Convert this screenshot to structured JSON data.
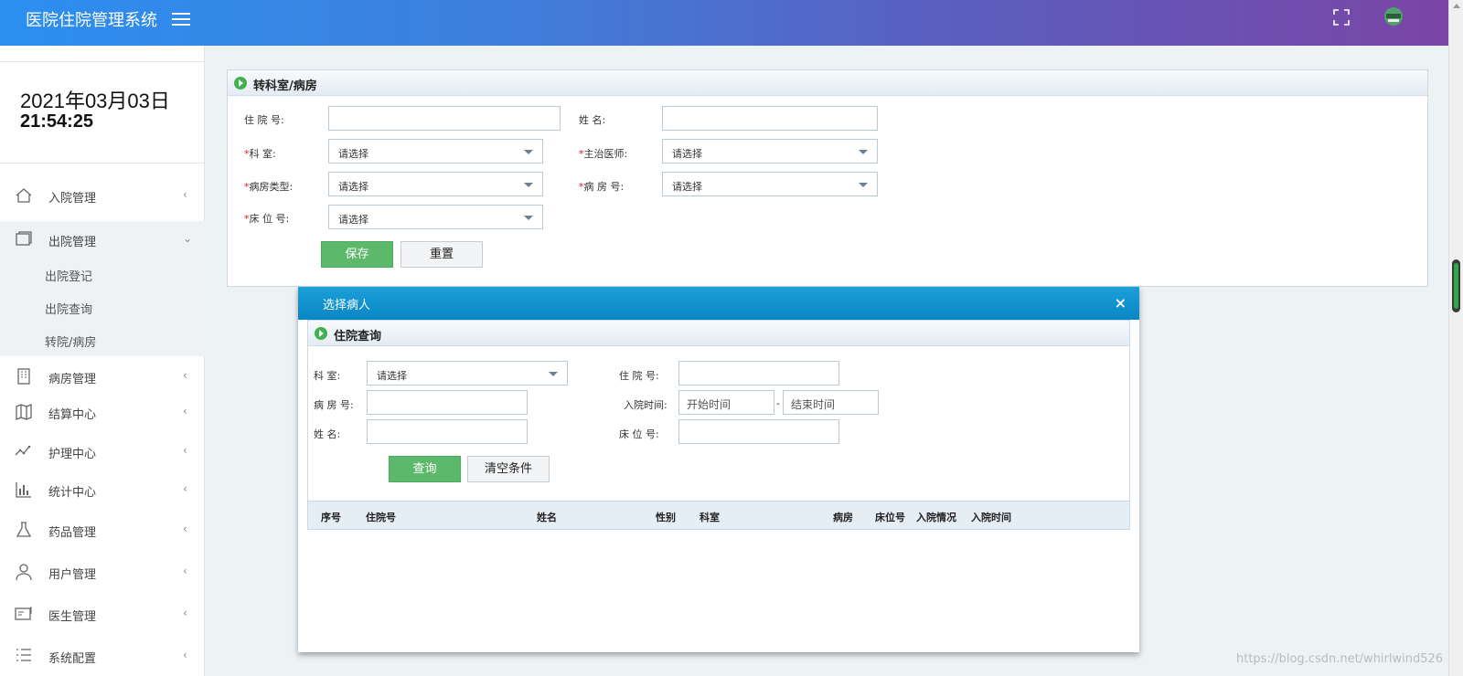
{
  "header": {
    "title": "医院住院管理系统"
  },
  "sidebar": {
    "date": "2021年03月03日",
    "time": "21:54:25",
    "items": [
      {
        "label": "入院管理",
        "icon": "home-icon",
        "chevron": "‹"
      },
      {
        "label": "出院管理",
        "icon": "window-icon",
        "chevron": "⌄"
      },
      {
        "label": "病房管理",
        "icon": "building-icon",
        "chevron": "‹"
      },
      {
        "label": "结算中心",
        "icon": "map-icon",
        "chevron": "‹"
      },
      {
        "label": "护理中心",
        "icon": "trend-icon",
        "chevron": "‹"
      },
      {
        "label": "统计中心",
        "icon": "bar-chart-icon",
        "chevron": "‹"
      },
      {
        "label": "药品管理",
        "icon": "flask-icon",
        "chevron": "‹"
      },
      {
        "label": "用户管理",
        "icon": "user-icon",
        "chevron": "‹"
      },
      {
        "label": "医生管理",
        "icon": "id-card-icon",
        "chevron": "‹"
      },
      {
        "label": "系统配置",
        "icon": "list-icon",
        "chevron": "‹"
      }
    ],
    "sub_items": [
      "出院登记",
      "出院查询",
      "转院/病房"
    ]
  },
  "form": {
    "title": "转科室/病房",
    "admission_no_label": "住 院 号:",
    "name_label": "姓    名:",
    "dept_label": "科    室:",
    "doctor_label": "主治医师:",
    "room_type_label": "病房类型:",
    "room_no_label": "病 房 号:",
    "bed_no_label": "床 位 号:",
    "select_placeholder": "请选择",
    "save_label": "保存",
    "reset_label": "重置"
  },
  "dialog": {
    "title": "选择病人",
    "close_label": "×",
    "query_title": "住院查询",
    "dept_label": "科    室:",
    "admission_no_label": "住 院 号:",
    "room_no_label": "病 房 号:",
    "admit_time_label": "入院时间:",
    "start_placeholder": "开始时间",
    "end_placeholder": "结束时间",
    "date_separator": "-",
    "name_label": "姓    名:",
    "bed_no_label": "床 位 号:",
    "select_placeholder": "请选择",
    "query_label": "查询",
    "clear_label": "清空条件",
    "columns": [
      "序号",
      "住院号",
      "姓名",
      "性别",
      "科室",
      "病房",
      "床位号",
      "入院情况",
      "入院时间"
    ]
  },
  "watermark": "https://blog.csdn.net/whirlwind526",
  "colors": {
    "accent_green": "#5cb86a",
    "dialog_blue": "#0a86c4",
    "required": "#e02020"
  }
}
